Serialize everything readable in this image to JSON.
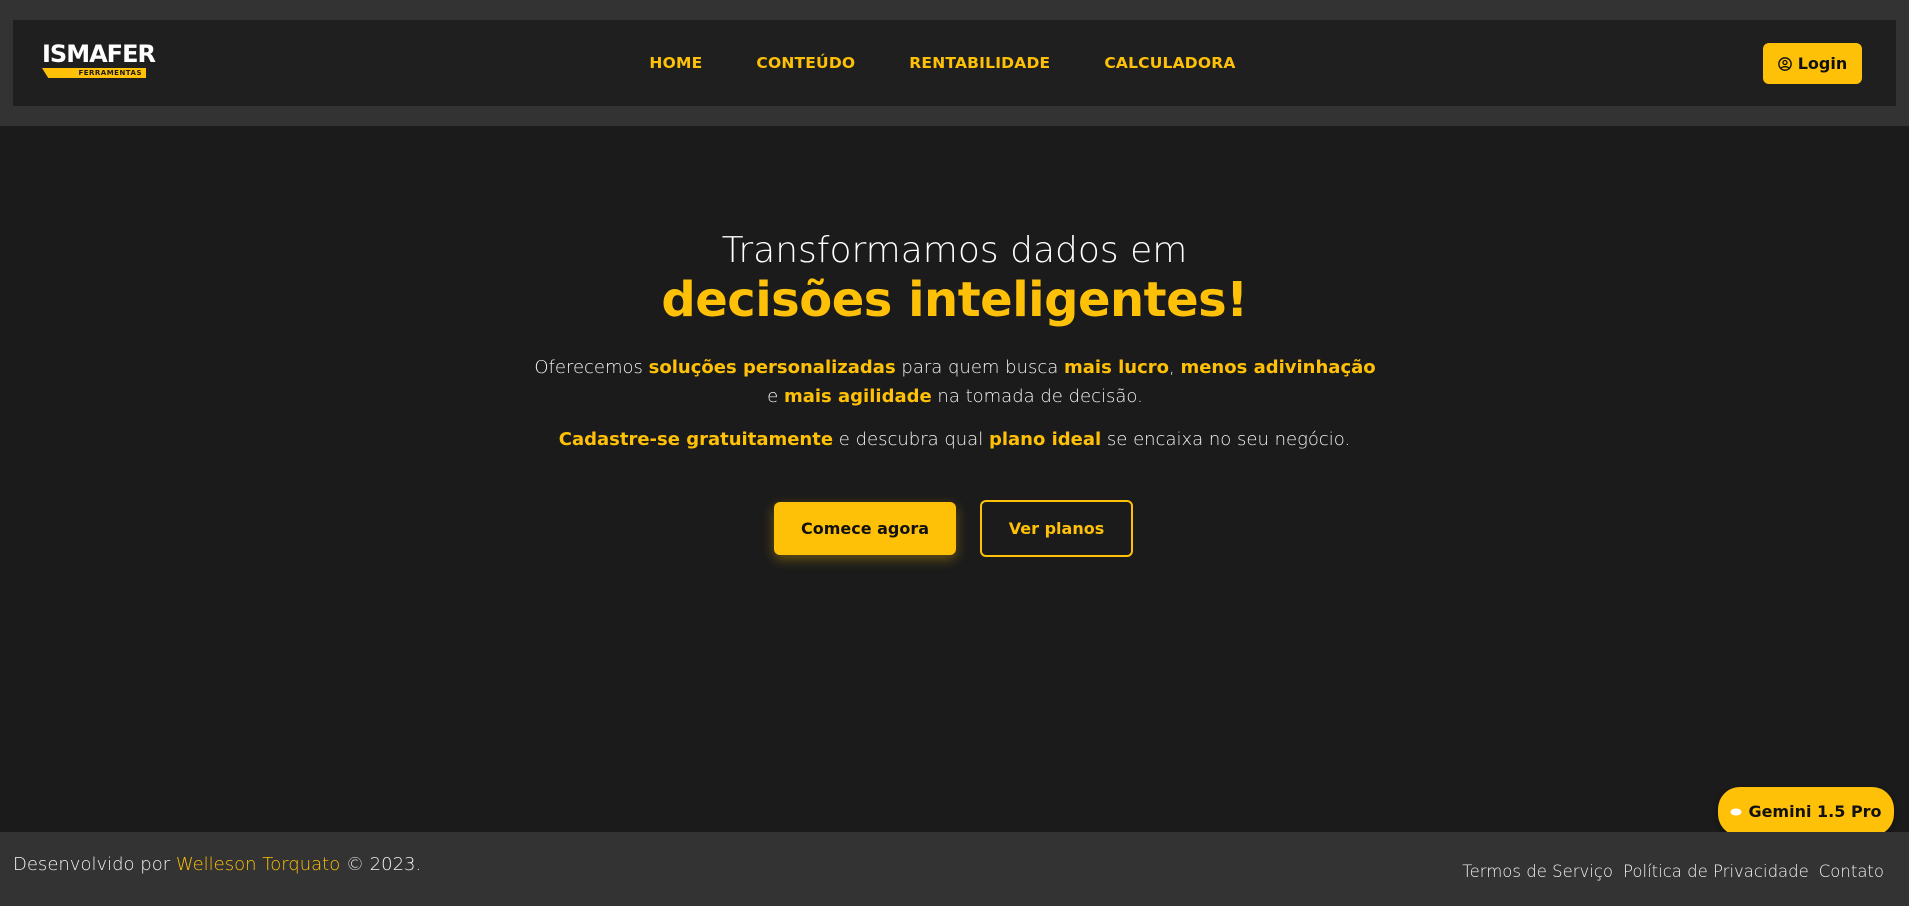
{
  "header": {
    "logo": {
      "name": "ISMAFER",
      "tagline": "FERRAMENTAS"
    },
    "nav": [
      "HOME",
      "CONTEÚDO",
      "RENTABILIDADE",
      "CALCULADORA"
    ],
    "login_label": "Login"
  },
  "hero": {
    "line1": "Transformamos dados em",
    "line2": "decisões inteligentes!",
    "p1": {
      "t1": "Oferecemos ",
      "h1": "soluções personalizadas",
      "t2": " para quem busca ",
      "h2": "mais lucro",
      "t3": ", ",
      "h3": "menos adivinhação",
      "t4": " e ",
      "h4": "mais agilidade",
      "t5": " na tomada de decisão."
    },
    "p2": {
      "h1": "Cadastre-se gratuitamente",
      "t1": " e descubra qual ",
      "h2": "plano ideal",
      "t2": " se encaixa no seu negócio."
    },
    "cta_primary": "Comece agora",
    "cta_secondary": "Ver planos"
  },
  "badge": {
    "label": "Gemini 1.5 Pro"
  },
  "footer": {
    "prefix": "Desenvolvido por ",
    "author": "Welleson Torquato",
    "suffix": " © 2023.",
    "links": [
      "Termos de Serviço",
      "Política de Privacidade",
      "Contato"
    ]
  },
  "colors": {
    "accent": "#ffc107",
    "background": "#1b1b1b",
    "header_band": "#333333",
    "navbar": "#1f1f1f"
  }
}
